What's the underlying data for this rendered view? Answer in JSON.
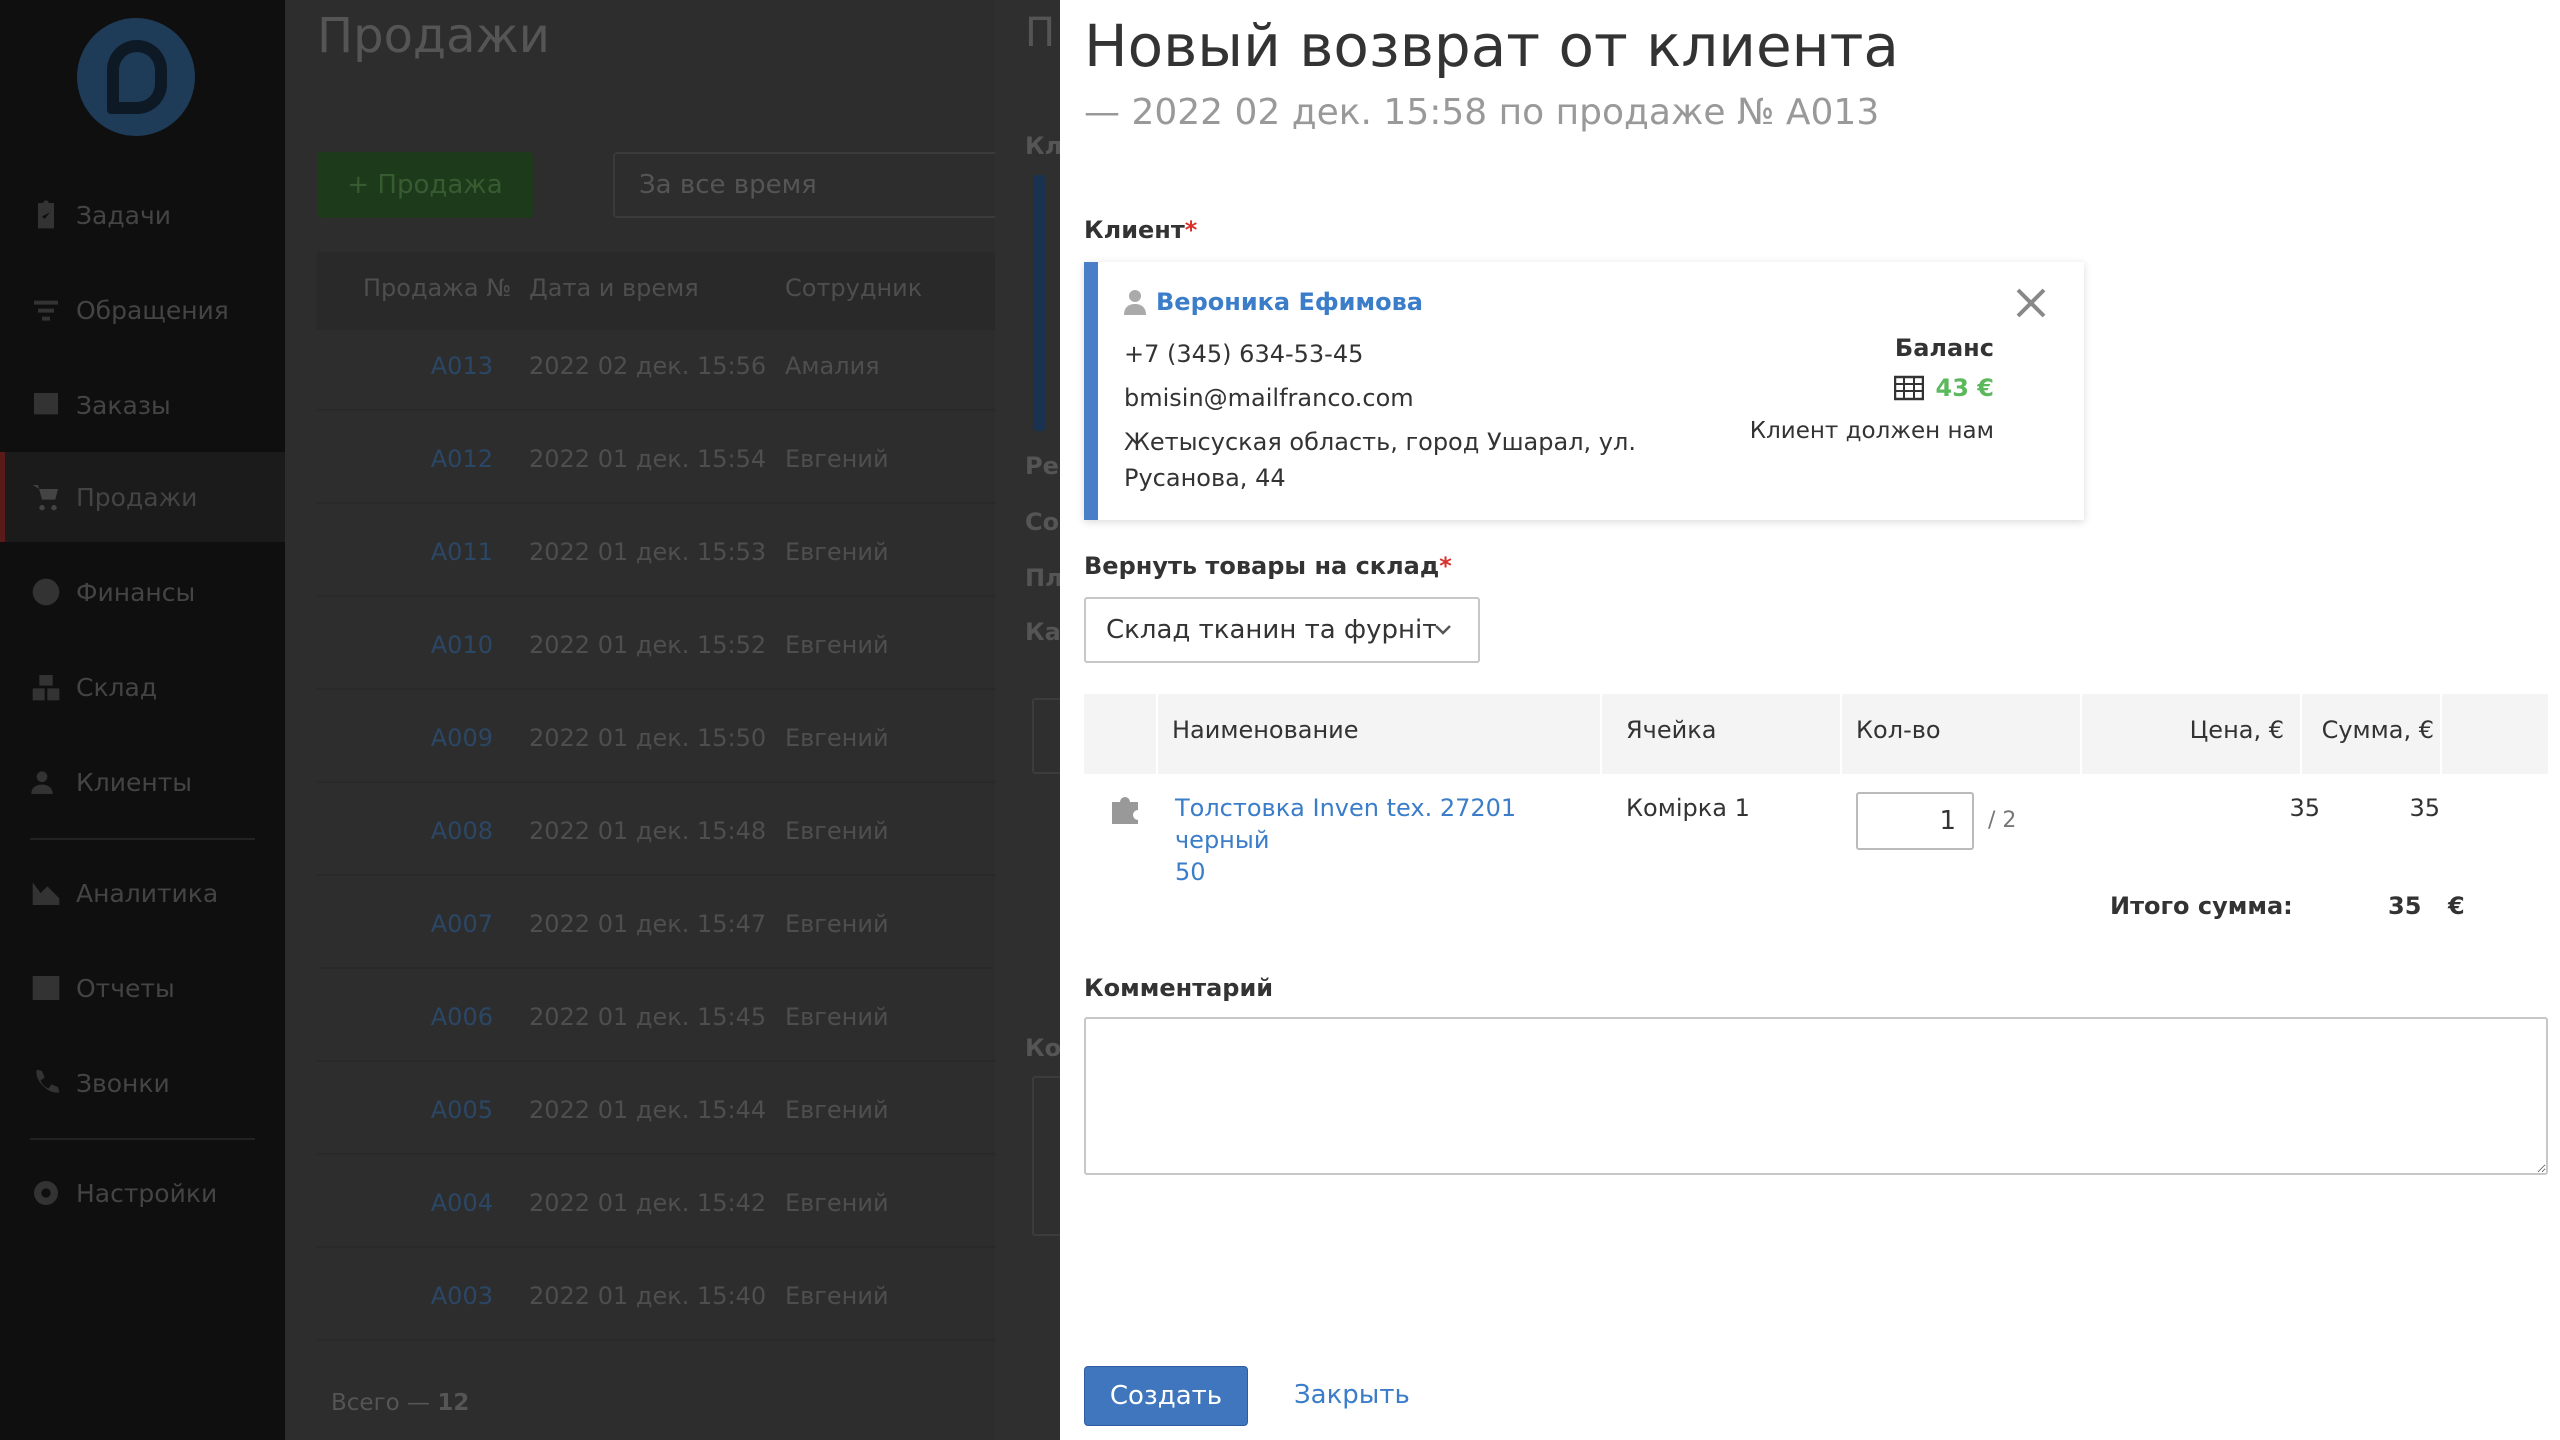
{
  "sidebar": {
    "items": [
      {
        "label": "Задачи",
        "icon": "clipboard-check-icon"
      },
      {
        "label": "Обращения",
        "icon": "filter-icon"
      },
      {
        "label": "Заказы",
        "icon": "order-icon"
      },
      {
        "label": "Продажи",
        "icon": "cart-icon",
        "active": true
      },
      {
        "label": "Финансы",
        "icon": "dollar-icon"
      },
      {
        "label": "Склад",
        "icon": "boxes-icon"
      },
      {
        "label": "Клиенты",
        "icon": "users-icon"
      },
      {
        "label": "Аналитика",
        "icon": "chart-area-icon"
      },
      {
        "label": "Отчеты",
        "icon": "report-icon"
      },
      {
        "label": "Звонки",
        "icon": "phone-icon"
      },
      {
        "label": "Настройки",
        "icon": "gear-icon"
      }
    ]
  },
  "sales": {
    "title": "Продажи",
    "add_label": "+ Продажа",
    "filter": "За все время",
    "columns": [
      "Продажа №",
      "Дата и время",
      "Сотрудник"
    ],
    "rows": [
      [
        "A013",
        "2022 02 дек. 15:56",
        "Амалия"
      ],
      [
        "A012",
        "2022 01 дек. 15:54",
        "Евгений"
      ],
      [
        "A011",
        "2022 01 дек. 15:53",
        "Евгений"
      ],
      [
        "A010",
        "2022 01 дек. 15:52",
        "Евгений"
      ],
      [
        "A009",
        "2022 01 дек. 15:50",
        "Евгений"
      ],
      [
        "A008",
        "2022 01 дек. 15:48",
        "Евгений"
      ],
      [
        "A007",
        "2022 01 дек. 15:47",
        "Евгений"
      ],
      [
        "A006",
        "2022 01 дек. 15:45",
        "Евгений"
      ],
      [
        "A005",
        "2022 01 дек. 15:44",
        "Евгений"
      ],
      [
        "A004",
        "2022 01 дек. 15:42",
        "Евгений"
      ],
      [
        "A003",
        "2022 01 дек. 15:40",
        "Евгений"
      ]
    ],
    "total_label": "Всего —",
    "total_count": "12"
  },
  "prev_modal": {
    "title_fragment": "П",
    "labels": [
      "Кл",
      "Ре",
      "Со",
      "Пл",
      "Ка",
      "Ко"
    ]
  },
  "modal": {
    "title": "Новый возврат от клиента",
    "subtitle": "— 2022 02 дек. 15:58 по продаже № A013",
    "client_label": "Клиент",
    "required_mark": "*",
    "client": {
      "name": "Вероника Ефимова",
      "phone": "+7 (345) 634-53-45",
      "email": "bmisin@mailfranco.com",
      "address_line1": "Жетысуская область, город Ушарал, ул.",
      "address_line2": "Русанова, 44",
      "balance_label": "Баланс",
      "balance": "43 €",
      "balance_note": "Клиент должен нам"
    },
    "warehouse_label": "Вернуть товары на склад",
    "warehouse_value": "Склад тканин та фурнітури",
    "table": {
      "columns": {
        "name": "Наименование",
        "cell": "Ячейка",
        "qty": "Кол-во",
        "price": "Цена, €",
        "sum": "Сумма, €"
      },
      "item": {
        "name_line1": "Толстовка Inven tex. 27201 черный",
        "name_line2": "50",
        "cell": "Комірка 1",
        "qty": "1",
        "qty_of": "/ 2",
        "price": "35",
        "sum": "35"
      },
      "total_label": "Итого сумма:",
      "total_value": "35",
      "currency": "€"
    },
    "comment_label": "Комментарий",
    "comment_value": "",
    "create_label": "Создать",
    "close_label": "Закрыть"
  },
  "colors": {
    "accent": "#3f76bd",
    "link": "#3b7dc9",
    "positive": "#5cb85c",
    "required": "#d9302c"
  }
}
